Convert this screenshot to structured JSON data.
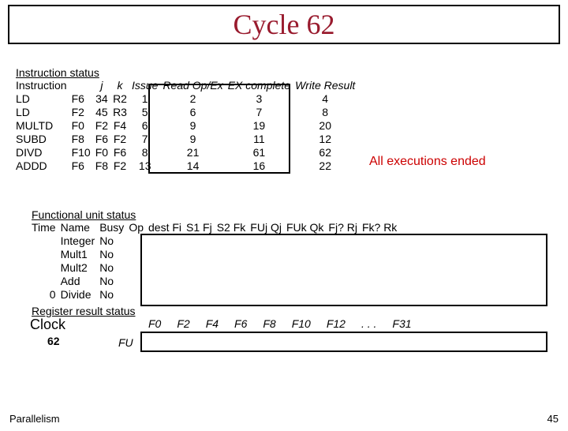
{
  "title": "Cycle 62",
  "instr": {
    "heading": "Instruction status",
    "hdr": {
      "inst": "Instruction",
      "j": "j",
      "k": "k",
      "issue": "Issue",
      "read": "Read Op/Ex",
      "ex": "EX complete",
      "write": "Write Result"
    },
    "rows": [
      {
        "op": "LD",
        "d": "F6",
        "j": "34",
        "k": "R2",
        "i": "1",
        "r": "2",
        "e": "3",
        "w": "4"
      },
      {
        "op": "LD",
        "d": "F2",
        "j": "45",
        "k": "R3",
        "i": "5",
        "r": "6",
        "e": "7",
        "w": "8"
      },
      {
        "op": "MULTD",
        "d": "F0",
        "j": "F2",
        "k": "F4",
        "i": "6",
        "r": "9",
        "e": "19",
        "w": "20"
      },
      {
        "op": "SUBD",
        "d": "F8",
        "j": "F6",
        "k": "F2",
        "i": "7",
        "r": "9",
        "e": "11",
        "w": "12"
      },
      {
        "op": "DIVD",
        "d": "F10",
        "j": "F0",
        "k": "F6",
        "i": "8",
        "r": "21",
        "e": "61",
        "w": "62"
      },
      {
        "op": "ADDD",
        "d": "F6",
        "j": "F8",
        "k": "F2",
        "i": "13",
        "r": "14",
        "e": "16",
        "w": "22"
      }
    ]
  },
  "note": "All executions ended",
  "fu": {
    "heading": "Functional unit status",
    "cols": {
      "time": "Time",
      "name": "Name",
      "busy": "Busy",
      "op": "Op",
      "dest": "dest Fi",
      "s1": "S1 Fj",
      "s2": "S2 Fk",
      "fuj": "FUj Qj",
      "fuk": "FUk Qk",
      "fj": "Fj? Rj",
      "fk": "Fk? Rk"
    },
    "rows": [
      {
        "t": "",
        "n": "Integer",
        "b": "No"
      },
      {
        "t": "",
        "n": "Mult1",
        "b": "No"
      },
      {
        "t": "",
        "n": "Mult2",
        "b": "No"
      },
      {
        "t": "",
        "n": "Add",
        "b": "No"
      },
      {
        "t": "0",
        "n": "Divide",
        "b": "No"
      }
    ]
  },
  "rrs": "Register result status",
  "clock_lbl": "Clock",
  "clock_val": "62",
  "fu_lbl": "FU",
  "regs": [
    "F0",
    "F2",
    "F4",
    "F6",
    "F8",
    "F10",
    "F12",
    ". . .",
    "F31"
  ],
  "footer_l": "Parallelism",
  "footer_r": "45"
}
